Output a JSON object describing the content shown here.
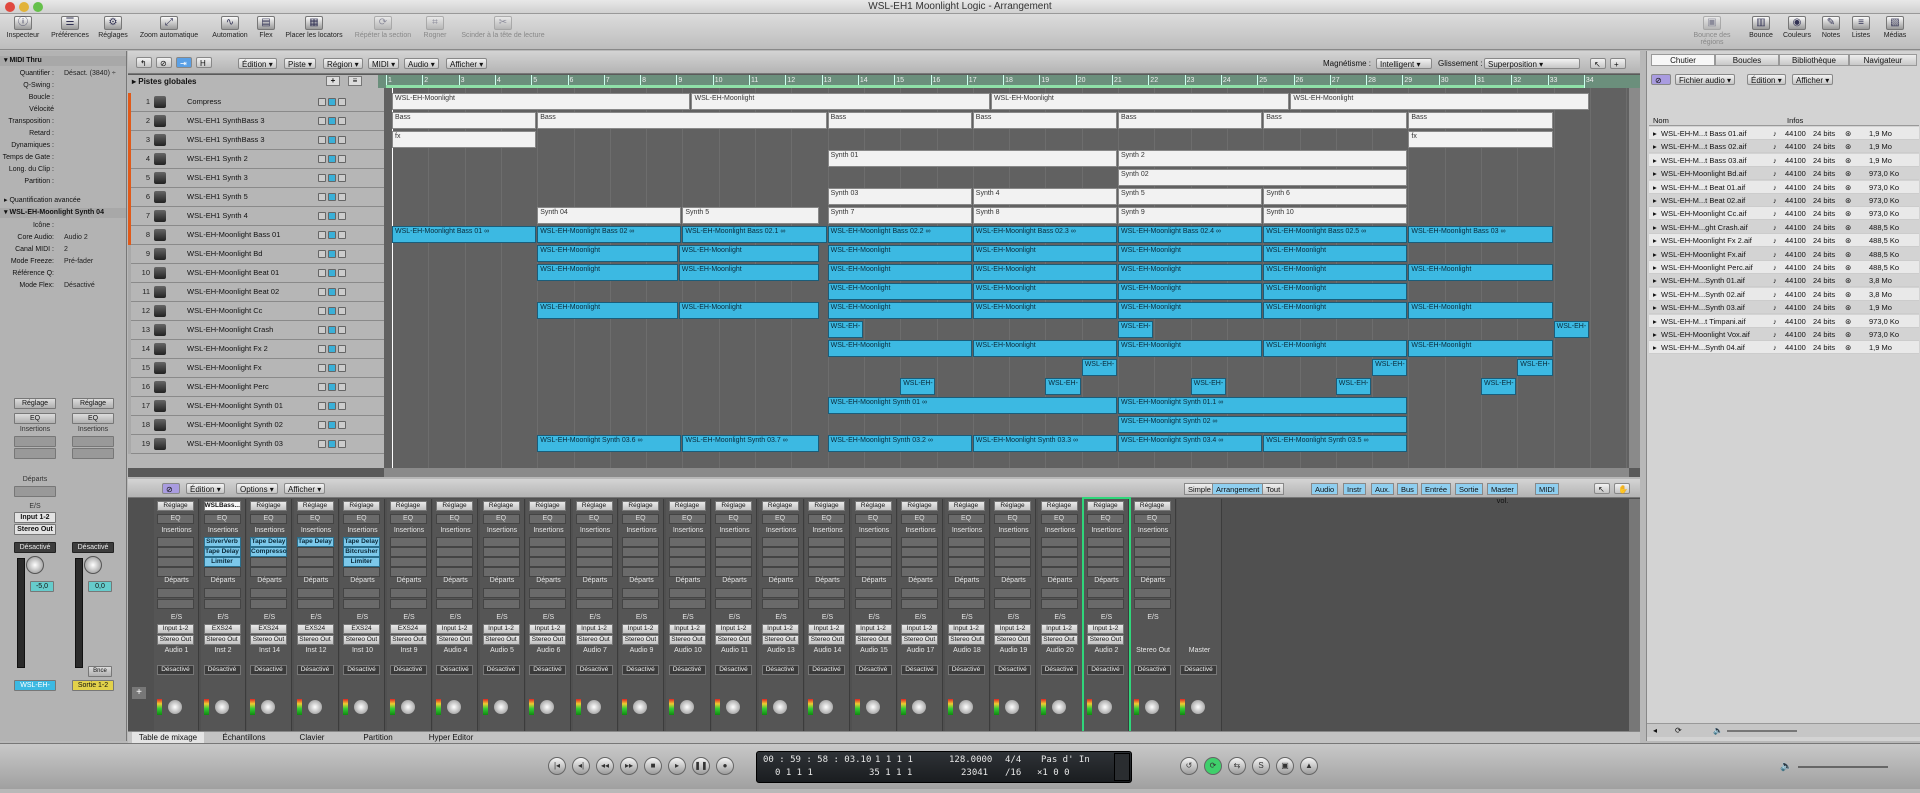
{
  "window": {
    "title": "WSL-EH1 Moonlight Logic - Arrangement"
  },
  "toolbar": {
    "left": [
      "Inspecteur",
      "Préférences",
      "Réglages",
      "Zoom automatique",
      "Automation",
      "Flex",
      "Placer les locators",
      "Répéter la section",
      "Rogner",
      "Scinder à la tête de lecture"
    ],
    "right": [
      "Bounce des régions",
      "Bounce",
      "Couleurs",
      "Notes",
      "Listes",
      "Médias"
    ]
  },
  "inspector": {
    "region_header": "MIDI Thru",
    "params": [
      {
        "k": "Quantifier :",
        "v": "Désact. (3840) ÷"
      },
      {
        "k": "Q-Swing :",
        "v": ""
      },
      {
        "k": "Boucle :",
        "v": ""
      },
      {
        "k": "Vélocité",
        "v": ""
      },
      {
        "k": "Transposition :",
        "v": ""
      },
      {
        "k": "Retard :",
        "v": ""
      },
      {
        "k": "Dynamiques :",
        "v": ""
      },
      {
        "k": "Temps de Gate :",
        "v": ""
      },
      {
        "k": "Long. du Clip :",
        "v": ""
      },
      {
        "k": "Partition :",
        "v": ""
      }
    ],
    "advanced": "Quantification avancée",
    "track_header": "WSL-EH-Moonlight Synth 04",
    "track_params": [
      {
        "k": "Icône :",
        "v": ""
      },
      {
        "k": "Core Audio:",
        "v": "Audio 2"
      },
      {
        "k": "Canal MIDI :",
        "v": "2"
      },
      {
        "k": "Mode Freeze:",
        "v": "Pré-fader"
      },
      {
        "k": "Référence Q:",
        "v": ""
      },
      {
        "k": "Mode Flex:",
        "v": "Désactivé"
      }
    ],
    "strip1": {
      "reglage": "Réglage",
      "eq": "EQ",
      "insertions": "Insertions",
      "departs": "Départs",
      "es": "E/S",
      "input": "Input 1-2",
      "output": "Stereo Out",
      "mode": "Désactivé",
      "value": "-5,0",
      "name": "WSL-EH-"
    },
    "strip2": {
      "reglage": "Réglage",
      "eq": "EQ",
      "insertions": "Insertions",
      "mode": "Désactivé",
      "value": "0,0",
      "name": "Sortie 1-2",
      "bnce": "Bnce"
    }
  },
  "arrange": {
    "menus": [
      "Édition",
      "Piste",
      "Région",
      "MIDI",
      "Audio",
      "Afficher"
    ],
    "magnet_label": "Magnétisme :",
    "magnet": "Intelligent",
    "drag_label": "Glissement :",
    "drag": "Superposition",
    "globals": "Pistes globales",
    "ruler": [
      "1",
      "2",
      "3",
      "4",
      "5",
      "6",
      "7",
      "8",
      "9",
      "10",
      "11",
      "12",
      "13",
      "14",
      "15",
      "16",
      "17",
      "18",
      "19",
      "20",
      "21",
      "22",
      "23",
      "24",
      "25",
      "26",
      "27",
      "28",
      "29",
      "30",
      "31",
      "32",
      "33",
      "34"
    ],
    "tracks": [
      {
        "n": "1",
        "name": "Compress"
      },
      {
        "n": "2",
        "name": "WSL-EH1 SynthBass 3"
      },
      {
        "n": "3",
        "name": "WSL-EH1 SynthBass 3"
      },
      {
        "n": "4",
        "name": "WSL-EH1 Synth 2"
      },
      {
        "n": "5",
        "name": "WSL-EH1 Synth 3"
      },
      {
        "n": "6",
        "name": "WSL-EH1 Synth 5"
      },
      {
        "n": "7",
        "name": "WSL-EH1 Synth 4"
      },
      {
        "n": "8",
        "name": "WSL-EH-Moonlight Bass 01"
      },
      {
        "n": "9",
        "name": "WSL-EH-Moonlight Bd"
      },
      {
        "n": "10",
        "name": "WSL-EH-Moonlight Beat 01"
      },
      {
        "n": "11",
        "name": "WSL-EH-Moonlight Beat 02"
      },
      {
        "n": "12",
        "name": "WSL-EH-Moonlight Cc"
      },
      {
        "n": "13",
        "name": "WSL-EH-Moonlight Crash"
      },
      {
        "n": "14",
        "name": "WSL-EH-Moonlight Fx 2"
      },
      {
        "n": "15",
        "name": "WSL-EH-Moonlight Fx"
      },
      {
        "n": "16",
        "name": "WSL-EH-Moonlight Perc"
      },
      {
        "n": "17",
        "name": "WSL-EH-Moonlight Synth 01"
      },
      {
        "n": "18",
        "name": "WSL-EH-Moonlight Synth 02"
      },
      {
        "n": "19",
        "name": "WSL-EH-Moonlight Synth 03"
      }
    ],
    "regions": [
      {
        "t": 0,
        "s": 1,
        "e": 34,
        "l": "WSL-EH-Moonlight",
        "c": "w",
        "rep": 4
      },
      {
        "t": 1,
        "s": 1,
        "e": 5,
        "l": "Bass",
        "c": "w"
      },
      {
        "t": 1,
        "s": 5,
        "e": 13,
        "l": "Bass",
        "c": "w"
      },
      {
        "t": 1,
        "s": 13,
        "e": 17,
        "l": "Bass",
        "c": "w"
      },
      {
        "t": 1,
        "s": 17,
        "e": 21,
        "l": "Bass",
        "c": "w"
      },
      {
        "t": 1,
        "s": 21,
        "e": 25,
        "l": "Bass",
        "c": "w"
      },
      {
        "t": 1,
        "s": 25,
        "e": 29,
        "l": "Bass",
        "c": "w"
      },
      {
        "t": 1,
        "s": 29,
        "e": 33,
        "l": "Bass",
        "c": "w"
      },
      {
        "t": 2,
        "s": 1,
        "e": 5,
        "l": "fx",
        "c": "w"
      },
      {
        "t": 2,
        "s": 29,
        "e": 33,
        "l": "fx",
        "c": "w"
      },
      {
        "t": 3,
        "s": 13,
        "e": 21,
        "l": "Synth 01",
        "c": "w"
      },
      {
        "t": 3,
        "s": 21,
        "e": 29,
        "l": "Synth 2",
        "c": "w"
      },
      {
        "t": 4,
        "s": 21,
        "e": 29,
        "l": "Synth 02",
        "c": "w"
      },
      {
        "t": 5,
        "s": 13,
        "e": 17,
        "l": "Synth 03",
        "c": "w"
      },
      {
        "t": 5,
        "s": 17,
        "e": 21,
        "l": "Synth 4",
        "c": "w"
      },
      {
        "t": 5,
        "s": 21,
        "e": 25,
        "l": "Synth 5",
        "c": "w"
      },
      {
        "t": 5,
        "s": 25,
        "e": 29,
        "l": "Synth 6",
        "c": "w"
      },
      {
        "t": 6,
        "s": 5,
        "e": 9,
        "l": "Synth 04",
        "c": "w"
      },
      {
        "t": 6,
        "s": 9,
        "e": 12.8,
        "l": "Synth 5",
        "c": "w"
      },
      {
        "t": 6,
        "s": 13,
        "e": 17,
        "l": "Synth 7",
        "c": "w"
      },
      {
        "t": 6,
        "s": 17,
        "e": 21,
        "l": "Synth 8",
        "c": "w"
      },
      {
        "t": 6,
        "s": 21,
        "e": 25,
        "l": "Synth 9",
        "c": "w"
      },
      {
        "t": 6,
        "s": 25,
        "e": 29,
        "l": "Synth 10",
        "c": "w"
      },
      {
        "t": 7,
        "s": 1,
        "e": 5,
        "l": "WSL-EH-Moonlight Bass 01 ∞",
        "c": "b"
      },
      {
        "t": 7,
        "s": 5,
        "e": 9,
        "l": "WSL-EH-Moonlight Bass 02 ∞",
        "c": "b"
      },
      {
        "t": 7,
        "s": 9,
        "e": 13,
        "l": "WSL-EH-Moonlight Bass 02.1 ∞",
        "c": "b"
      },
      {
        "t": 7,
        "s": 13,
        "e": 17,
        "l": "WSL-EH-Moonlight Bass 02.2 ∞",
        "c": "b"
      },
      {
        "t": 7,
        "s": 17,
        "e": 21,
        "l": "WSL-EH-Moonlight Bass 02.3 ∞",
        "c": "b"
      },
      {
        "t": 7,
        "s": 21,
        "e": 25,
        "l": "WSL-EH-Moonlight Bass 02.4 ∞",
        "c": "b"
      },
      {
        "t": 7,
        "s": 25,
        "e": 29,
        "l": "WSL-EH-Moonlight Bass 02.5 ∞",
        "c": "b"
      },
      {
        "t": 7,
        "s": 29,
        "e": 33,
        "l": "WSL-EH-Moonlight Bass 03 ∞",
        "c": "b"
      },
      {
        "t": 8,
        "s": 5,
        "e": 12.8,
        "l": "WSL-EH-Moonlight",
        "c": "b",
        "rep": 2
      },
      {
        "t": 8,
        "s": 13,
        "e": 29,
        "l": "WSL-EH-Moonlight",
        "c": "b",
        "rep": 4
      },
      {
        "t": 9,
        "s": 5,
        "e": 12.8,
        "l": "WSL-EH-Moonlight",
        "c": "b",
        "rep": 2
      },
      {
        "t": 9,
        "s": 13,
        "e": 33,
        "l": "WSL-EH-Moonlight",
        "c": "b",
        "rep": 5
      },
      {
        "t": 10,
        "s": 13,
        "e": 29,
        "l": "WSL-EH-Moonlight",
        "c": "b",
        "rep": 4
      },
      {
        "t": 11,
        "s": 5,
        "e": 12.8,
        "l": "WSL-EH-Moonlight",
        "c": "b",
        "rep": 2
      },
      {
        "t": 11,
        "s": 13,
        "e": 33,
        "l": "WSL-EH-Moonlight",
        "c": "b",
        "rep": 5
      },
      {
        "t": 12,
        "s": 13,
        "e": 14,
        "l": "WSL-EH-",
        "c": "b"
      },
      {
        "t": 12,
        "s": 21,
        "e": 22,
        "l": "WSL-EH-",
        "c": "b"
      },
      {
        "t": 12,
        "s": 33,
        "e": 34,
        "l": "WSL-EH-",
        "c": "b"
      },
      {
        "t": 13,
        "s": 13,
        "e": 33,
        "l": "WSL-EH-Moonlight",
        "c": "b",
        "rep": 5
      },
      {
        "t": 14,
        "s": 20,
        "e": 21,
        "l": "WSL-EH-",
        "c": "b"
      },
      {
        "t": 14,
        "s": 28,
        "e": 29,
        "l": "WSL-EH-",
        "c": "b"
      },
      {
        "t": 14,
        "s": 32,
        "e": 33,
        "l": "WSL-EH-",
        "c": "b"
      },
      {
        "t": 15,
        "s": 15,
        "e": 16,
        "l": "WSL-EH-",
        "c": "b"
      },
      {
        "t": 15,
        "s": 19,
        "e": 20,
        "l": "WSL-EH-",
        "c": "b"
      },
      {
        "t": 15,
        "s": 23,
        "e": 24,
        "l": "WSL-EH-",
        "c": "b"
      },
      {
        "t": 15,
        "s": 27,
        "e": 28,
        "l": "WSL-EH-",
        "c": "b"
      },
      {
        "t": 15,
        "s": 31,
        "e": 32,
        "l": "WSL-EH-",
        "c": "b"
      },
      {
        "t": 16,
        "s": 13,
        "e": 21,
        "l": "WSL-EH-Moonlight Synth 01 ∞",
        "c": "b"
      },
      {
        "t": 16,
        "s": 21,
        "e": 29,
        "l": "WSL-EH-Moonlight Synth 01.1 ∞",
        "c": "b"
      },
      {
        "t": 17,
        "s": 21,
        "e": 29,
        "l": "WSL-EH-Moonlight Synth 02 ∞",
        "c": "b"
      },
      {
        "t": 18,
        "s": 5,
        "e": 9,
        "l": "WSL-EH-Moonlight Synth 03.6 ∞",
        "c": "b"
      },
      {
        "t": 18,
        "s": 9,
        "e": 12.8,
        "l": "WSL-EH-Moonlight Synth 03.7 ∞",
        "c": "b"
      },
      {
        "t": 18,
        "s": 13,
        "e": 17,
        "l": "WSL-EH-Moonlight Synth 03.2 ∞",
        "c": "b"
      },
      {
        "t": 18,
        "s": 17,
        "e": 21,
        "l": "WSL-EH-Moonlight Synth 03.3 ∞",
        "c": "b"
      },
      {
        "t": 18,
        "s": 21,
        "e": 25,
        "l": "WSL-EH-Moonlight Synth 03.4 ∞",
        "c": "b"
      },
      {
        "t": 18,
        "s": 25,
        "e": 29,
        "l": "WSL-EH-Moonlight Synth 03.5 ∞",
        "c": "b"
      }
    ]
  },
  "browser": {
    "tabs": [
      "Chutier",
      "Boucles",
      "Bibliothèque",
      "Navigateur"
    ],
    "menus": [
      "Fichier audio",
      "Édition",
      "Afficher"
    ],
    "col_name": "Nom",
    "col_info": "Infos",
    "files": [
      {
        "n": "WSL-EH-M...t Bass 01.aif",
        "r": "44100",
        "b": "24 bits",
        "s": "1,9 Mo"
      },
      {
        "n": "WSL-EH-M...t Bass 02.aif",
        "r": "44100",
        "b": "24 bits",
        "s": "1,9 Mo"
      },
      {
        "n": "WSL-EH-M...t Bass 03.aif",
        "r": "44100",
        "b": "24 bits",
        "s": "1,9 Mo"
      },
      {
        "n": "WSL-EH-Moonlight Bd.aif",
        "r": "44100",
        "b": "24 bits",
        "s": "973,0 Ko"
      },
      {
        "n": "WSL-EH-M...t Beat 01.aif",
        "r": "44100",
        "b": "24 bits",
        "s": "973,0 Ko"
      },
      {
        "n": "WSL-EH-M...t Beat 02.aif",
        "r": "44100",
        "b": "24 bits",
        "s": "973,0 Ko"
      },
      {
        "n": "WSL-EH-Moonlight Cc.aif",
        "r": "44100",
        "b": "24 bits",
        "s": "973,0 Ko"
      },
      {
        "n": "WSL-EH-M...ght Crash.aif",
        "r": "44100",
        "b": "24 bits",
        "s": "488,5 Ko"
      },
      {
        "n": "WSL-EH-Moonlight Fx 2.aif",
        "r": "44100",
        "b": "24 bits",
        "s": "488,5 Ko"
      },
      {
        "n": "WSL-EH-Moonlight Fx.aif",
        "r": "44100",
        "b": "24 bits",
        "s": "488,5 Ko"
      },
      {
        "n": "WSL-EH-Moonlight Perc.aif",
        "r": "44100",
        "b": "24 bits",
        "s": "488,5 Ko"
      },
      {
        "n": "WSL-EH-M...Synth 01.aif",
        "r": "44100",
        "b": "24 bits",
        "s": "3,8 Mo"
      },
      {
        "n": "WSL-EH-M...Synth 02.aif",
        "r": "44100",
        "b": "24 bits",
        "s": "3,8 Mo"
      },
      {
        "n": "WSL-EH-M...Synth 03.aif",
        "r": "44100",
        "b": "24 bits",
        "s": "1,9 Mo"
      },
      {
        "n": "WSL-EH-M...t Timpani.aif",
        "r": "44100",
        "b": "24 bits",
        "s": "973,0 Ko"
      },
      {
        "n": "WSL-EH-Moonlight Vox.aif",
        "r": "44100",
        "b": "24 bits",
        "s": "973,0 Ko"
      },
      {
        "n": "WSL-EH-M...Synth 04.aif",
        "r": "44100",
        "b": "24 bits",
        "s": "1,9 Mo"
      }
    ]
  },
  "mixer": {
    "menus": [
      "Édition",
      "Options",
      "Afficher"
    ],
    "views": [
      "Simple",
      "Arrangement",
      "Tout"
    ],
    "filters": [
      "Audio",
      "Instr",
      "Aux.",
      "Bus",
      "Entrée",
      "Sortie",
      "Master vol.",
      "MIDI"
    ],
    "labels": {
      "reglage": "Réglage",
      "eq": "EQ",
      "ins": "Insertions",
      "dep": "Départs",
      "es": "E/S",
      "mode": "Désactivé"
    },
    "strips": [
      {
        "name": "Audio 1",
        "in": "Input 1-2",
        "out": "Stereo Out",
        "plugs": [],
        "top": "Réglage"
      },
      {
        "name": "Inst 2",
        "in": "EXS24",
        "out": "Stereo Out",
        "plugs": [
          "SilverVerb",
          "Tape Delay",
          "Limiter"
        ],
        "top": "WSLBass..."
      },
      {
        "name": "Inst 14",
        "in": "EXS24",
        "out": "Stereo Out",
        "plugs": [
          "Tape Delay",
          "Compresso"
        ],
        "top": "Réglage"
      },
      {
        "name": "Inst 12",
        "in": "EXS24",
        "out": "Stereo Out",
        "plugs": [
          "Tape Delay"
        ],
        "top": "Réglage"
      },
      {
        "name": "Inst 10",
        "in": "EXS24",
        "out": "Stereo Out",
        "plugs": [
          "Tape Delay",
          "Bitcrusher",
          "Limiter"
        ],
        "top": "Réglage"
      },
      {
        "name": "Inst 9",
        "in": "EXS24",
        "out": "Stereo Out",
        "plugs": [],
        "top": "Réglage"
      },
      {
        "name": "Audio 4",
        "in": "Input 1-2",
        "out": "Stereo Out",
        "plugs": [],
        "top": "Réglage"
      },
      {
        "name": "Audio 5",
        "in": "Input 1-2",
        "out": "Stereo Out",
        "plugs": [],
        "top": "Réglage"
      },
      {
        "name": "Audio 6",
        "in": "Input 1-2",
        "out": "Stereo Out",
        "plugs": [],
        "top": "Réglage"
      },
      {
        "name": "Audio 7",
        "in": "Input 1-2",
        "out": "Stereo Out",
        "plugs": [],
        "top": "Réglage"
      },
      {
        "name": "Audio 9",
        "in": "Input 1-2",
        "out": "Stereo Out",
        "plugs": [],
        "top": "Réglage"
      },
      {
        "name": "Audio 10",
        "in": "Input 1-2",
        "out": "Stereo Out",
        "plugs": [],
        "top": "Réglage"
      },
      {
        "name": "Audio 11",
        "in": "Input 1-2",
        "out": "Stereo Out",
        "plugs": [],
        "top": "Réglage"
      },
      {
        "name": "Audio 13",
        "in": "Input 1-2",
        "out": "Stereo Out",
        "plugs": [],
        "top": "Réglage"
      },
      {
        "name": "Audio 14",
        "in": "Input 1-2",
        "out": "Stereo Out",
        "plugs": [],
        "top": "Réglage"
      },
      {
        "name": "Audio 15",
        "in": "Input 1-2",
        "out": "Stereo Out",
        "plugs": [],
        "top": "Réglage"
      },
      {
        "name": "Audio 17",
        "in": "Input 1-2",
        "out": "Stereo Out",
        "plugs": [],
        "top": "Réglage"
      },
      {
        "name": "Audio 18",
        "in": "Input 1-2",
        "out": "Stereo Out",
        "plugs": [],
        "top": "Réglage"
      },
      {
        "name": "Audio 19",
        "in": "Input 1-2",
        "out": "Stereo Out",
        "plugs": [],
        "top": "Réglage"
      },
      {
        "name": "Audio 20",
        "in": "Input 1-2",
        "out": "Stereo Out",
        "plugs": [],
        "top": "Réglage"
      },
      {
        "name": "Audio 2",
        "in": "Input 1-2",
        "out": "Stereo Out",
        "plugs": [],
        "top": "Réglage",
        "sel": true
      },
      {
        "name": "Stereo Out",
        "in": "",
        "out": "",
        "plugs": [],
        "top": "Réglage"
      },
      {
        "name": "Master",
        "in": "",
        "out": "",
        "plugs": [],
        "top": ""
      }
    ]
  },
  "bottom_tabs": [
    "Table de mixage",
    "Échantillons",
    "Clavier",
    "Partition",
    "Hyper Editor"
  ],
  "transport": {
    "time": "00 : 59 : 58 : 03.10",
    "time_sub": "0 1 1 1",
    "bars": "1 1 1 1",
    "bars_sub": "35 1 1 1",
    "tempo": "128.0000",
    "tempo_sub": "23041",
    "sig": "4/4",
    "div": "/16",
    "mode": "Pas d' In",
    "mode_sub": "×1 0 0"
  },
  "colors": {
    "region_blue": "#3cb9e2",
    "track_accent": "#e05a1a",
    "selected_strip": "#2fd67a"
  }
}
